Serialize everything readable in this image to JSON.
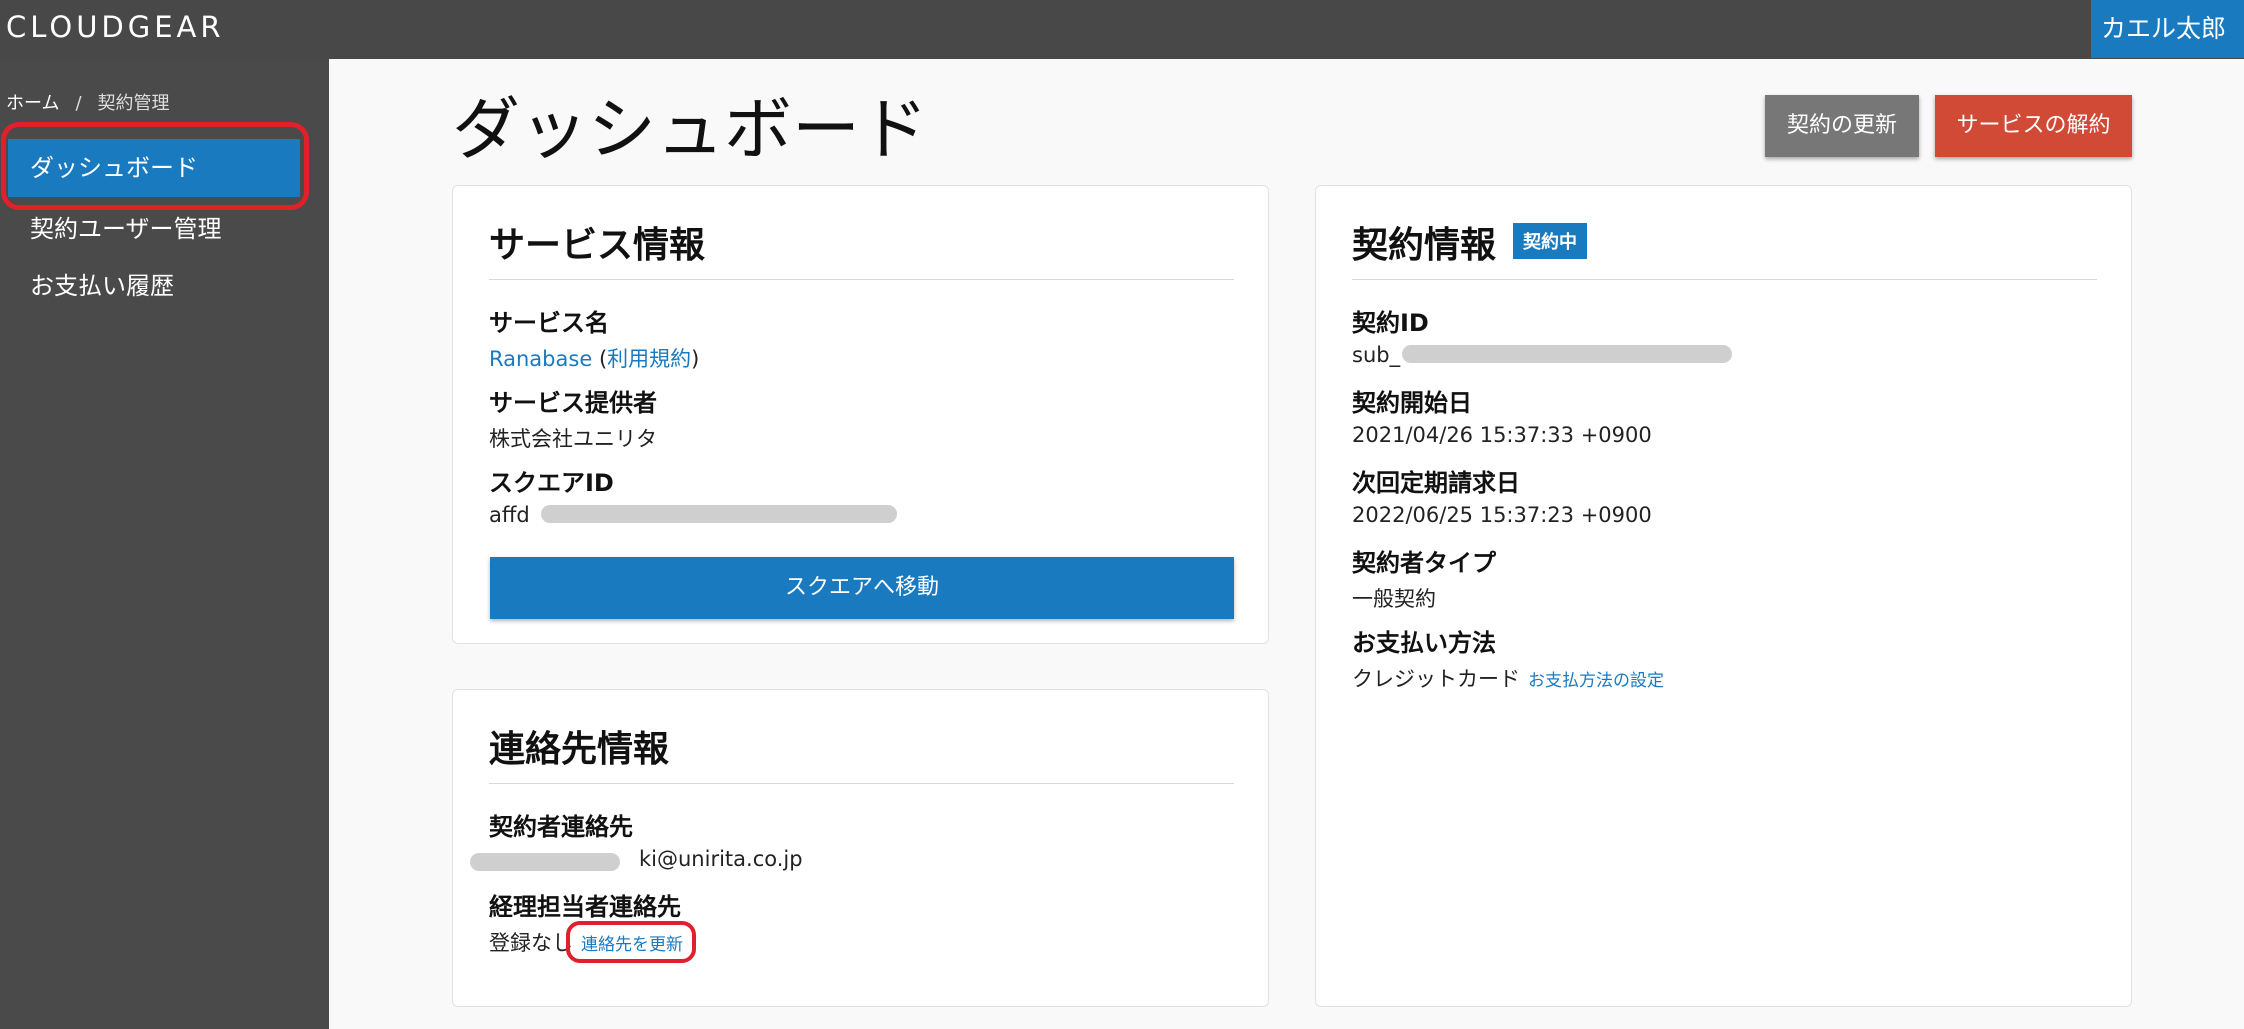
{
  "header": {
    "logo": "CLOUDGEAR",
    "user_name": "カエル太郎"
  },
  "sidebar": {
    "breadcrumb": {
      "home": "ホーム",
      "separator": "/",
      "current": "契約管理"
    },
    "items": [
      {
        "label": "ダッシュボード",
        "active": true
      },
      {
        "label": "契約ユーザー管理",
        "active": false
      },
      {
        "label": "お支払い履歴",
        "active": false
      }
    ]
  },
  "page": {
    "title": "ダッシュボード",
    "renew_button": "契約の更新",
    "cancel_button": "サービスの解約"
  },
  "service_card": {
    "title": "サービス情報",
    "service_name_label": "サービス名",
    "service_name": "Ranabase",
    "terms_open": "(",
    "terms_link": "利用規約",
    "terms_close": ")",
    "provider_label": "サービス提供者",
    "provider": "株式会社ユニリタ",
    "square_id_label": "スクエアID",
    "square_id_visible": "affd",
    "go_button": "スクエアへ移動"
  },
  "contract_card": {
    "title": "契約情報",
    "status": "契約中",
    "contract_id_label": "契約ID",
    "contract_id_visible": "sub_",
    "start_label": "契約開始日",
    "start_value": "2021/04/26 15:37:33 +0900",
    "next_billing_label": "次回定期請求日",
    "next_billing_value": "2022/06/25 15:37:23 +0900",
    "type_label": "契約者タイプ",
    "type_value": "一般契約",
    "payment_label": "お支払い方法",
    "payment_value": "クレジットカード",
    "payment_link": "お支払方法の設定"
  },
  "contact_card": {
    "title": "連絡先情報",
    "contractor_label": "契約者連絡先",
    "contractor_email_visible": "ki@unirita.co.jp",
    "accounting_label": "経理担当者連絡先",
    "accounting_value": "登録なし",
    "update_link": "連絡先を更新"
  },
  "colors": {
    "topbar": "#484848",
    "sidebar": "#4a4a4a",
    "accent": "#1a7ac0",
    "danger": "#d04a35",
    "neutral_button": "#777777",
    "highlight": "#e0202a"
  }
}
